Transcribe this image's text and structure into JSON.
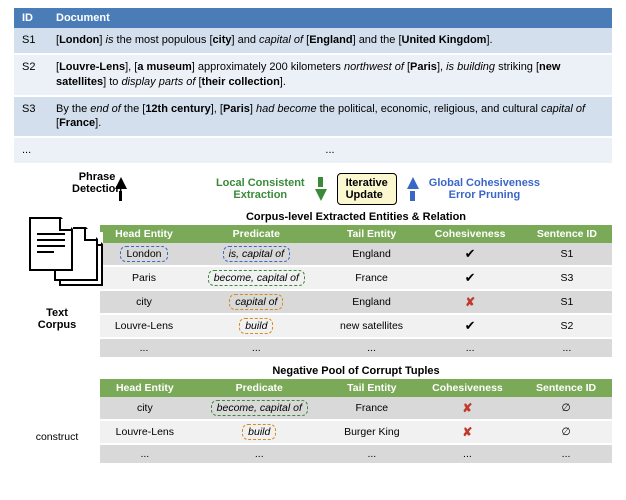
{
  "doc_header": {
    "id": "ID",
    "document": "Document"
  },
  "docs": [
    {
      "id": "S1",
      "html": "[<b>London</b>] <i>is</i> the most populous [<b>city</b>] and <i>capital of</i> [<b>England</b>] and the [<b>United Kingdom</b>]."
    },
    {
      "id": "S2",
      "html": "[<b>Louvre-Lens</b>], [<b>a museum</b>] approximately 200 kilometers <i>northwest of</i> [<b>Paris</b>], <i>is building</i> striking [<b>new satellites</b>] to <i>display parts of</i> [<b>their collection</b>]."
    },
    {
      "id": "S3",
      "html": "By the <i>end of</i> the [<b>12th century</b>], [<b>Paris</b>] <i>had become</i> the political, economic, religious, and cultural <i>capital of</i> [<b>France</b>]."
    },
    {
      "id": "...",
      "html": "..."
    }
  ],
  "labels": {
    "phrase_detection": "Phrase\nDetection",
    "lce": "Local Consistent\nExtraction",
    "iterative": "Iterative\nUpdate",
    "gce": "Global Cohesiveness\nError Pruning",
    "text_corpus": "Text\nCorpus",
    "construct": "construct",
    "corpus_title": "Corpus-level Extracted Entities & Relation",
    "neg_title": "Negative Pool of Corrupt Tuples"
  },
  "cols": {
    "head": "Head Entity",
    "pred": "Predicate",
    "tail": "Tail Entity",
    "coh": "Cohesiveness",
    "sid": "Sentence ID"
  },
  "extracted": [
    {
      "head": "London",
      "pred": "is, capital of",
      "tail": "England",
      "coh": "✔",
      "sid": "S1",
      "dash_head": true,
      "dash_pred": "blue"
    },
    {
      "head": "Paris",
      "pred": "become, capital of",
      "tail": "France",
      "coh": "✔",
      "sid": "S3",
      "dash_pred": "green"
    },
    {
      "head": "city",
      "pred": "capital of",
      "tail": "England",
      "coh": "✘",
      "sid": "S1",
      "dash_pred": "orange"
    },
    {
      "head": "Louvre-Lens",
      "pred": "build",
      "tail": "new satellites",
      "coh": "✔",
      "sid": "S2",
      "dash_pred": "orange"
    },
    {
      "head": "...",
      "pred": "...",
      "tail": "...",
      "coh": "...",
      "sid": "..."
    }
  ],
  "negative": [
    {
      "head": "city",
      "pred": "become, capital of",
      "tail": "France",
      "coh": "✘",
      "sid": "∅",
      "dash_pred": "green"
    },
    {
      "head": "Louvre-Lens",
      "pred": "build",
      "tail": "Burger King",
      "coh": "✘",
      "sid": "∅",
      "dash_pred": "orange"
    },
    {
      "head": "...",
      "pred": "...",
      "tail": "...",
      "coh": "...",
      "sid": "..."
    }
  ]
}
